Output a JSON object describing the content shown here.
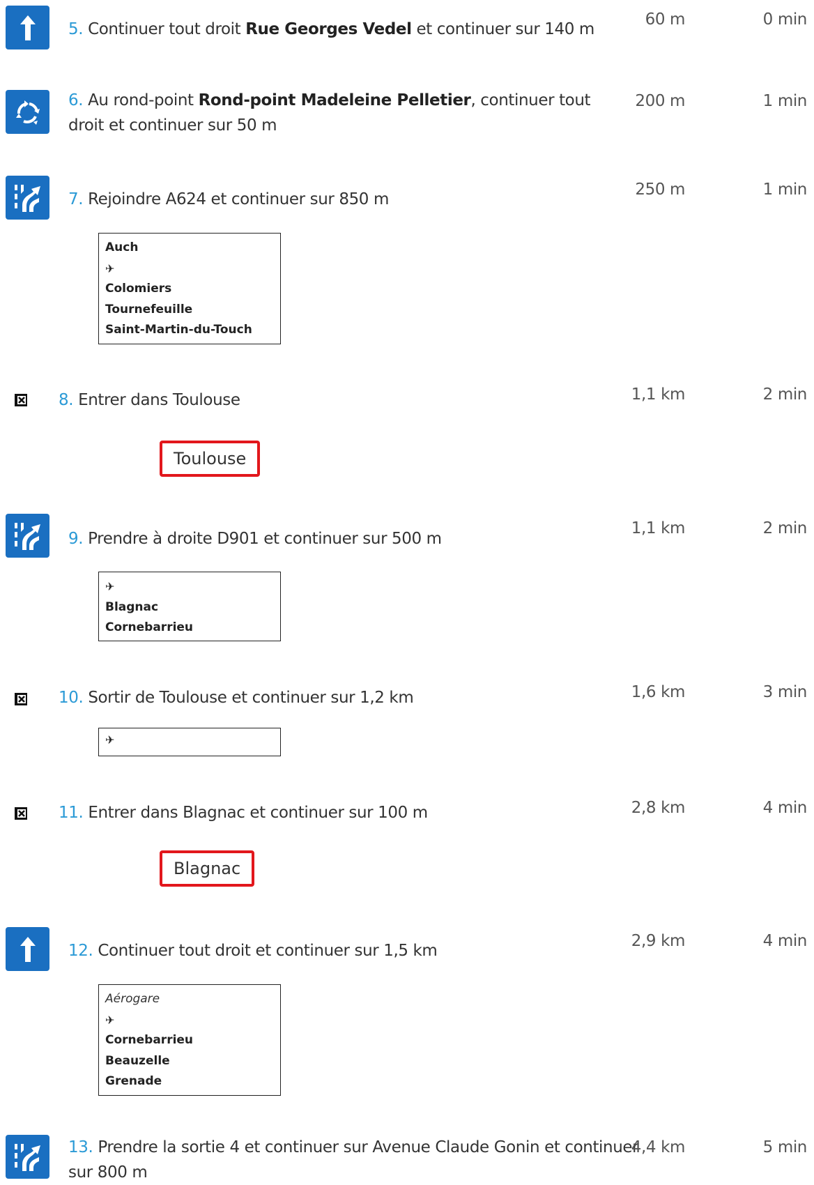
{
  "steps": [
    {
      "num": "5.",
      "pre": "Continuer tout droit ",
      "bold": "Rue Georges Vedel",
      "post": " et continuer sur 140 m",
      "distance": "60 m",
      "time": "0 min",
      "icon": "straight-arrow-icon"
    },
    {
      "num": "6.",
      "pre": "Au rond-point ",
      "bold": "Rond-point Madeleine Pelletier",
      "post": ", continuer tout droit et continuer sur 50 m",
      "distance": "200 m",
      "time": "1 min",
      "icon": "roundabout-icon"
    },
    {
      "num": "7.",
      "pre": "Rejoindre A624 et continuer sur 850 m",
      "bold": "",
      "post": "",
      "distance": "250 m",
      "time": "1 min",
      "icon": "merge-lane-icon",
      "sign": [
        "Auch",
        "✈",
        "Colomiers",
        "Tournefeuille",
        "Saint-Martin-du-Touch"
      ]
    },
    {
      "num": "8.",
      "pre": "Entrer dans Toulouse",
      "bold": "",
      "post": "",
      "distance": "1,1 km",
      "time": "2 min",
      "icon": "city-entry-icon",
      "city": "Toulouse"
    },
    {
      "num": "9.",
      "pre": "Prendre à droite D901 et continuer sur 500 m",
      "bold": "",
      "post": "",
      "distance": "1,1 km",
      "time": "2 min",
      "icon": "merge-lane-icon",
      "sign": [
        "✈",
        "Blagnac",
        "Cornebarrieu"
      ]
    },
    {
      "num": "10.",
      "pre": "Sortir de Toulouse et continuer sur 1,2 km",
      "bold": "",
      "post": "",
      "distance": "1,6 km",
      "time": "3 min",
      "icon": "city-exit-icon",
      "sign": [
        "✈"
      ]
    },
    {
      "num": "11.",
      "pre": "Entrer dans Blagnac et continuer sur 100 m",
      "bold": "",
      "post": "",
      "distance": "2,8 km",
      "time": "4 min",
      "icon": "city-entry-icon",
      "city": "Blagnac"
    },
    {
      "num": "12.",
      "pre": "Continuer tout droit et continuer sur 1,5 km",
      "bold": "",
      "post": "",
      "distance": "2,9 km",
      "time": "4 min",
      "icon": "straight-arrow-icon",
      "sign_italic": "Aérogare",
      "sign": [
        "✈",
        "Cornebarrieu",
        "Beauzelle",
        "Grenade"
      ]
    },
    {
      "num": "13.",
      "pre": "Prendre la sortie 4 et continuer sur Avenue Claude Gonin et continuer sur 800 m",
      "bold": "",
      "post": "",
      "distance": "4,4 km",
      "time": "5 min",
      "icon": "merge-lane-icon"
    }
  ],
  "colors": {
    "icon_blue": "#1a6fc1",
    "step_number": "#2b9ad6",
    "city_border": "#e2171c"
  }
}
